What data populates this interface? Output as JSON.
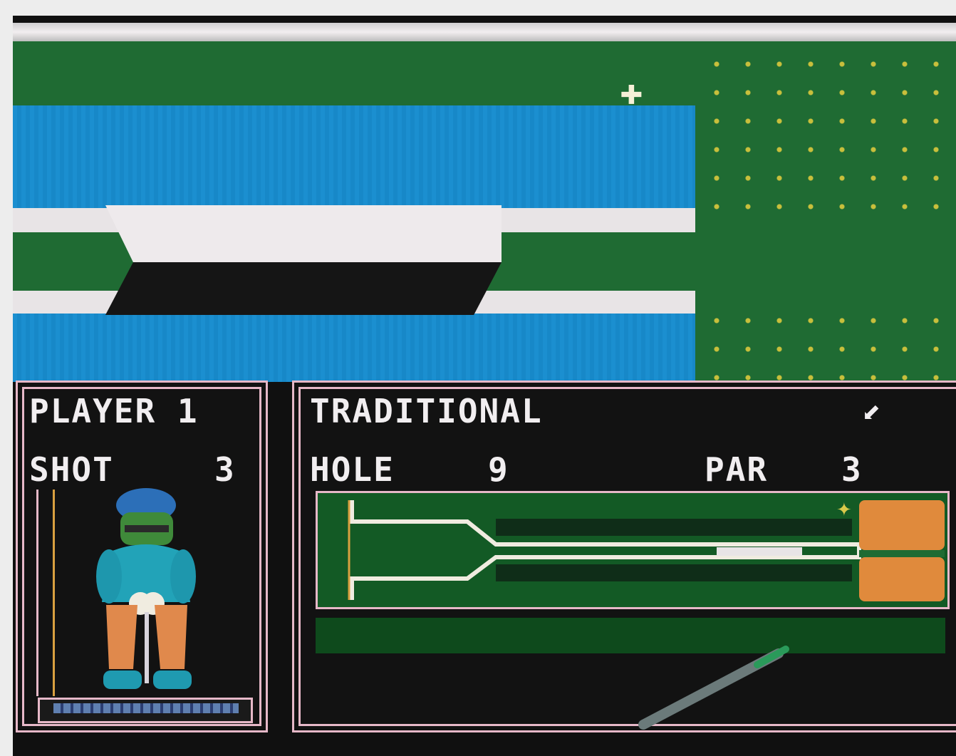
{
  "player_panel": {
    "player_label": "PLAYER 1",
    "shot_label": "SHOT",
    "shot_value": "3"
  },
  "course_panel": {
    "mode_label": "TRADITIONAL",
    "wind_indicator": "wind-arrow-icon",
    "hole_label": "HOLE",
    "hole_value": "9",
    "par_label": "PAR",
    "par_value": "3"
  },
  "colors": {
    "water": "#1b8fd0",
    "fairway": "#1f6b33",
    "sand": "#e8e4e6",
    "green_area": "#e08a3c",
    "panel_border": "#e6b8c8"
  }
}
